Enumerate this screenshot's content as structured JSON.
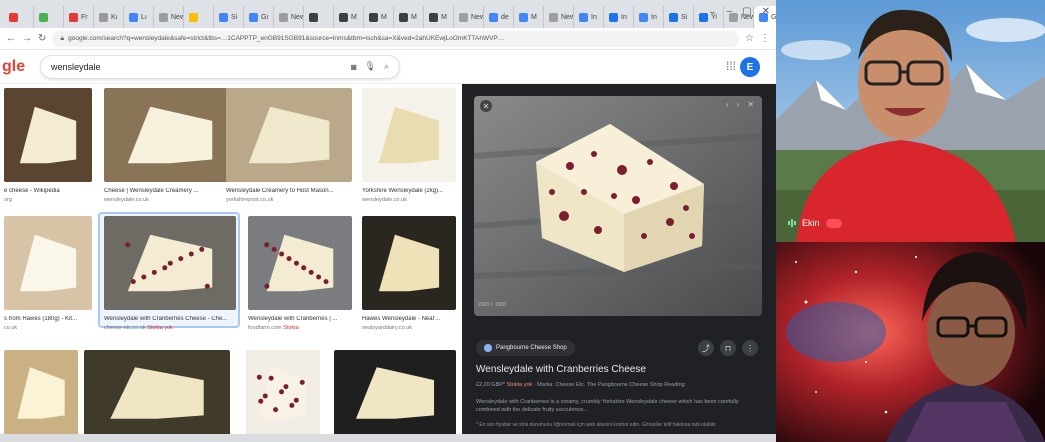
{
  "browser": {
    "tabs": [
      {
        "label": "",
        "color": "#e53935"
      },
      {
        "label": "",
        "color": "#4caf50"
      },
      {
        "label": "Fr",
        "color": "#e53935"
      },
      {
        "label": "Kı",
        "color": "#999999"
      },
      {
        "label": "Lı",
        "color": "#4285f4"
      },
      {
        "label": "New",
        "color": "#9e9e9e"
      },
      {
        "label": "",
        "color": "#fbbc04"
      },
      {
        "label": "Si",
        "color": "#4285f4"
      },
      {
        "label": "Gı",
        "color": "#4285f4"
      },
      {
        "label": "New",
        "color": "#9e9e9e"
      },
      {
        "label": "",
        "color": "#3c4043"
      },
      {
        "label": "M",
        "color": "#3c4043"
      },
      {
        "label": "M",
        "color": "#3c4043"
      },
      {
        "label": "M",
        "color": "#3c4043"
      },
      {
        "label": "M",
        "color": "#3c4043"
      },
      {
        "label": "New",
        "color": "#9e9e9e"
      },
      {
        "label": "de",
        "color": "#4285f4"
      },
      {
        "label": "M",
        "color": "#4285f4"
      },
      {
        "label": "New",
        "color": "#9e9e9e"
      },
      {
        "label": "In",
        "color": "#4285f4"
      },
      {
        "label": "In",
        "color": "#1a73e8"
      },
      {
        "label": "In",
        "color": "#4285f4"
      },
      {
        "label": "Si",
        "color": "#1a73e8"
      },
      {
        "label": "Yi",
        "color": "#1a73e8"
      },
      {
        "label": "New",
        "color": "#9e9e9e"
      },
      {
        "label": "G",
        "color": "#4285f4"
      }
    ],
    "new_tab": "+",
    "window_controls": [
      "⌄",
      "–",
      "▢",
      "✕"
    ],
    "url": "google.com/search?q=wensleydale&safe=strict&tbs=…1CAPPTP_enGB91SGB91&source=lnms&tbm=isch&sa=X&ved=2ahUKEwjLoOmKTTAhWVP…",
    "star": "☆",
    "menu": "⋮"
  },
  "google": {
    "logo_visible": "gle",
    "query": "wensleydale",
    "apps_icon": "⋮⋮⋮",
    "avatar_letter": "E"
  },
  "results": [
    {
      "caption": "e cheese - Wikipedia",
      "source": "org",
      "bg": "#5a4630",
      "fg": "#f3ecd2"
    },
    {
      "caption": "Cheese | Wensleydale Creamery ...",
      "source": "wensleydale.co.uk",
      "bg": "#8a7458",
      "fg": "#f6f1dc"
    },
    {
      "caption": "Wensleydale Creamery to Host Mason...",
      "source": "yorkshirepost.co.uk",
      "bg": "#b9a98a",
      "fg": "#f0e8cc"
    },
    {
      "caption": "Yorkshire Wensleydale (2kg)...",
      "source": "wensleydale.co.uk",
      "bg": "#f5f2ea",
      "fg": "#e9dcb0"
    },
    {
      "caption": "s from Hawes (180g) - Kit...",
      "source": "co.uk",
      "bg": "#d7c4a6",
      "fg": "#faf7ea"
    },
    {
      "caption": "Wensleydale with Cranberries Cheese - Che...",
      "source": "cheese-etc.co.uk",
      "source_tag": "Stokta yok",
      "bg": "#6e6a64",
      "fg": "#f4ecd2"
    },
    {
      "caption": "Wensleydale with Cranberries | ...",
      "source": "foodfarm.com",
      "source_tag": "Stokta",
      "bg": "#7a7c80",
      "fg": "#f4ecd2"
    },
    {
      "caption": "Hawes Wensleydale - Neal'...",
      "source": "nealsyarddairy.co.uk",
      "bg": "#2a2620",
      "fg": "#efe2b8"
    },
    {
      "caption": "",
      "source": "",
      "bg": "#c9b183",
      "fg": "#fbf3d6"
    },
    {
      "caption": "",
      "source": "",
      "bg": "#3f3a2a",
      "fg": "#f0e6c4"
    },
    {
      "caption": "",
      "source": "",
      "bg": "#f2eee6",
      "fg": "#f7f2e3"
    },
    {
      "caption": "",
      "source": "",
      "bg": "#1f1f1f",
      "fg": "#f0e6c4"
    }
  ],
  "preview": {
    "image_size": "2000 × 1500",
    "source_chip": "Pangbourne Cheese Shop",
    "title": "Wensleydale with Cranberries Cheese",
    "price": "£2,20 GBP*",
    "stock": "Stokta yok",
    "meta": "· Marka: Cheese Etc. The Pangbourne Cheese Shop Reading",
    "description": "Wensleydale with Cranberries is a creamy, crumbly Yorkshire Wensleydale cheese which has been carefully combined with the delicate fruity succulence...",
    "notice": "* En son fiyatlar ve stok durumunu öğrenmek için web sitesini kontrol edin. Görseller telif hakkına tabi olabilir.",
    "share_icon": "share-icon",
    "save_icon": "bookmark-icon",
    "more_icon": "more-icon"
  },
  "video": {
    "participant_1": "Ekin",
    "sky_color": "#7fb3df",
    "shirt_color": "#d8262c",
    "nebula_color": "#8b1a1a"
  }
}
